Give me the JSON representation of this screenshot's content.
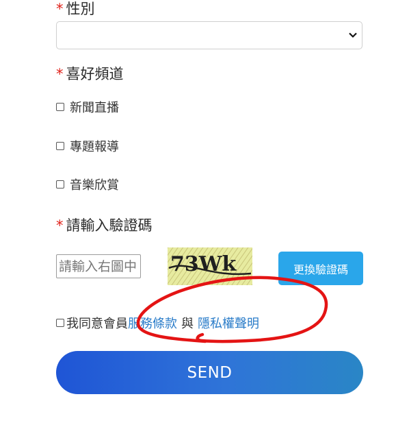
{
  "gender": {
    "required_mark": "*",
    "label": "性別",
    "selected": ""
  },
  "channels": {
    "required_mark": "*",
    "label": "喜好頻道",
    "options": [
      "新聞直播",
      "專題報導",
      "音樂欣賞"
    ]
  },
  "captcha": {
    "required_mark": "*",
    "label": "請輸入驗證碼",
    "placeholder": "請輸入右圖中",
    "image_text": "73Wk",
    "refresh_label": "更換驗證碼"
  },
  "agreement": {
    "prefix": "我同意會員",
    "terms_link": "服務條款",
    "conjunction": "與",
    "privacy_link": "隱私權聲明"
  },
  "submit": {
    "label": "SEND"
  },
  "colors": {
    "required": "#e0221b",
    "link": "#2a7cc9",
    "refresh_button": "#2aa6ea",
    "send_gradient_start": "#1f55d6",
    "send_gradient_end": "#2a86c6",
    "annotation": "#e41414"
  }
}
